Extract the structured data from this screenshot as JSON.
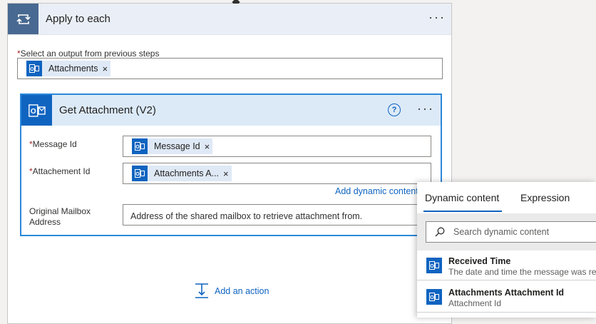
{
  "apply_to_each": {
    "title": "Apply to each",
    "more_label": "···",
    "select_label": "Select an output from previous steps",
    "required_mark": "*",
    "token": {
      "label": "Attachments",
      "close": "×"
    }
  },
  "get_attachment": {
    "title": "Get Attachment (V2)",
    "help_label": "?",
    "more_label": "···",
    "fields": {
      "message_id": {
        "label": "Message Id",
        "token_label": "Message Id",
        "close": "×"
      },
      "attachment_id": {
        "label": "Attachement Id",
        "token_label": "Attachments A...",
        "close": "×"
      },
      "mailbox": {
        "label": "Original Mailbox Address",
        "placeholder": "Address of the shared mailbox to retrieve attachment from."
      }
    },
    "add_dynamic_content": "Add dynamic content"
  },
  "add_action": {
    "label": "Add an action"
  },
  "dynamic_panel": {
    "tabs": {
      "dynamic": "Dynamic content",
      "expression": "Expression"
    },
    "search_placeholder": "Search dynamic content",
    "items": [
      {
        "title": "Received Time",
        "description": "The date and time the message was rece"
      },
      {
        "title": "Attachments Attachment Id",
        "description": "Attachment Id"
      }
    ]
  },
  "colors": {
    "accent": "#0f64c0",
    "loop": "#486991",
    "selected_border": "#2b88d8",
    "required": "#a4262c"
  }
}
